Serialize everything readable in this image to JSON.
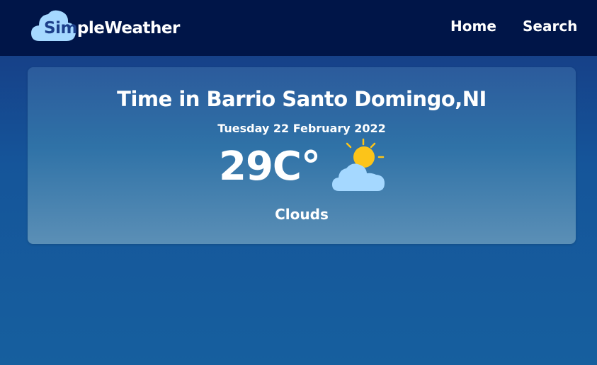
{
  "brand": {
    "part1": "Sim",
    "part2": "pleWeather",
    "icon": "cloud-logo-icon"
  },
  "nav": {
    "home": "Home",
    "search": "Search"
  },
  "weather": {
    "title": "Time in Barrio Santo Domingo,NI",
    "date": "Tuesday 22 February 2022",
    "temperature": "29C°",
    "condition": "Clouds",
    "icon": "partly-cloudy-icon"
  },
  "colors": {
    "navbar": "#001548",
    "sun": "#fcc419",
    "cloud": "#a5d8ff",
    "text": "#ffffff"
  }
}
